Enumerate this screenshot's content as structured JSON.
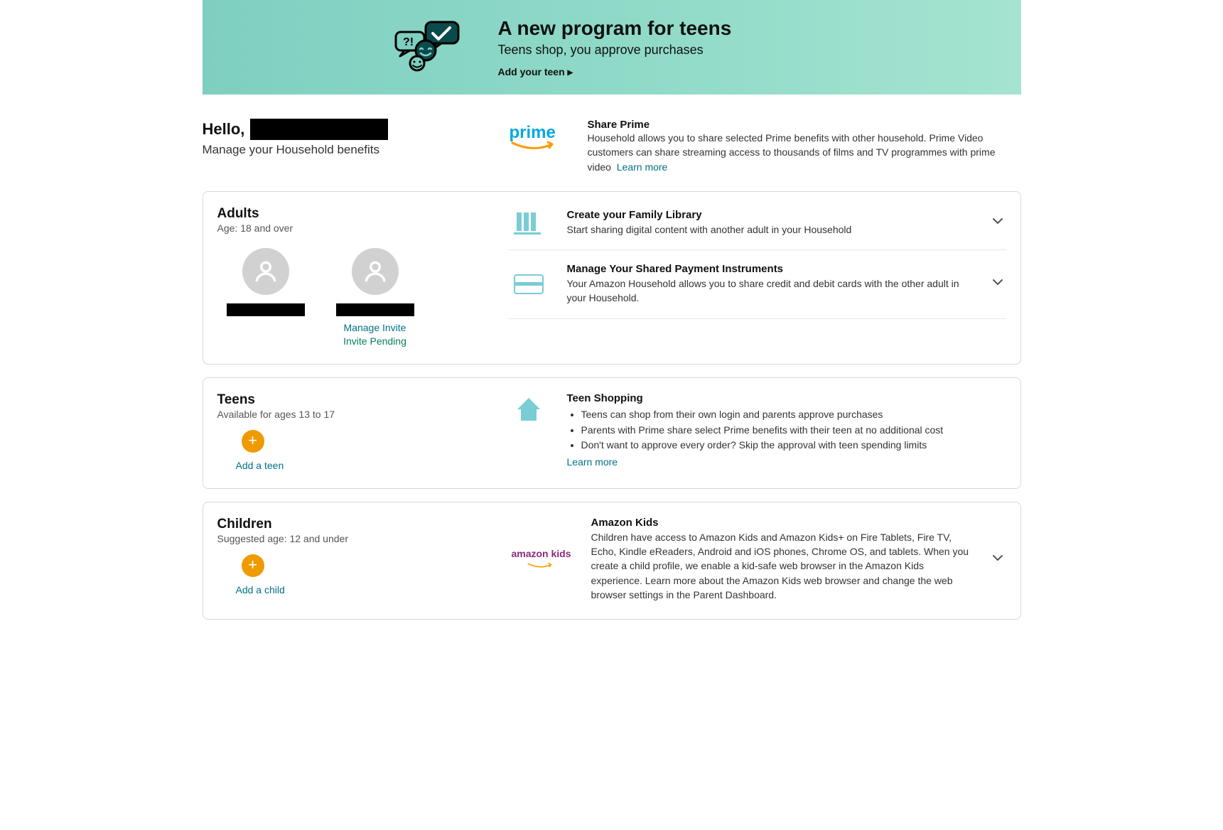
{
  "banner": {
    "title": "A new program for teens",
    "subtitle": "Teens shop, you approve purchases",
    "cta": "Add your teen"
  },
  "greeting": {
    "hello": "Hello,",
    "manage": "Manage your Household benefits"
  },
  "prime": {
    "logo_text": "prime",
    "title": "Share Prime",
    "desc": "Household allows you to share selected Prime benefits with other household. Prime Video customers can share streaming access to thousands of films and TV programmes with prime video",
    "learn_more": "Learn more"
  },
  "adults": {
    "heading": "Adults",
    "age": "Age: 18 and over",
    "manage_invite": "Manage Invite",
    "invite_pending": "Invite Pending",
    "family_library": {
      "title": "Create your Family Library",
      "desc": "Start sharing digital content with another adult in your Household"
    },
    "payment": {
      "title": "Manage Your Shared Payment Instruments",
      "desc": "Your Amazon Household allows you to share credit and debit cards with the other adult in your Household."
    }
  },
  "teens": {
    "heading": "Teens",
    "age": "Available for ages 13 to 17",
    "add_label": "Add a teen",
    "shopping_title": "Teen Shopping",
    "bullets": [
      "Teens can shop from their own login and parents approve purchases",
      "Parents with Prime share select Prime benefits with their teen at no additional cost",
      "Don't want to approve every order? Skip the approval with teen spending limits"
    ],
    "learn_more": "Learn more"
  },
  "children": {
    "heading": "Children",
    "age": "Suggested age: 12 and under",
    "add_label": "Add a child",
    "kids_logo": "amazon kids",
    "kids_title": "Amazon Kids",
    "kids_desc": "Children have access to Amazon Kids and Amazon Kids+ on Fire Tablets, Fire TV, Echo, Kindle eReaders, Android and iOS phones, Chrome OS, and tablets. When you create a child profile, we enable a kid-safe web browser in the Amazon Kids experience. Learn more about the Amazon Kids web browser and change the web browser settings in the Parent Dashboard."
  }
}
